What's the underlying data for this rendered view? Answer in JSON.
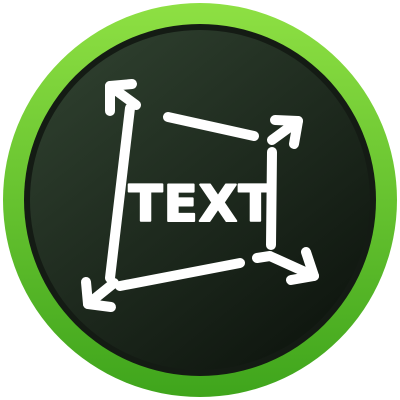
{
  "icon": {
    "name": "transform-text-icon",
    "label": "TEXT",
    "colors": {
      "ring_light": "#8EE043",
      "ring_dark": "#3FA51C",
      "inner_light": "#2E3F2E",
      "inner_dark": "#0E150E",
      "inner_edge": "#141B14",
      "stroke": "#FFFFFF"
    }
  }
}
